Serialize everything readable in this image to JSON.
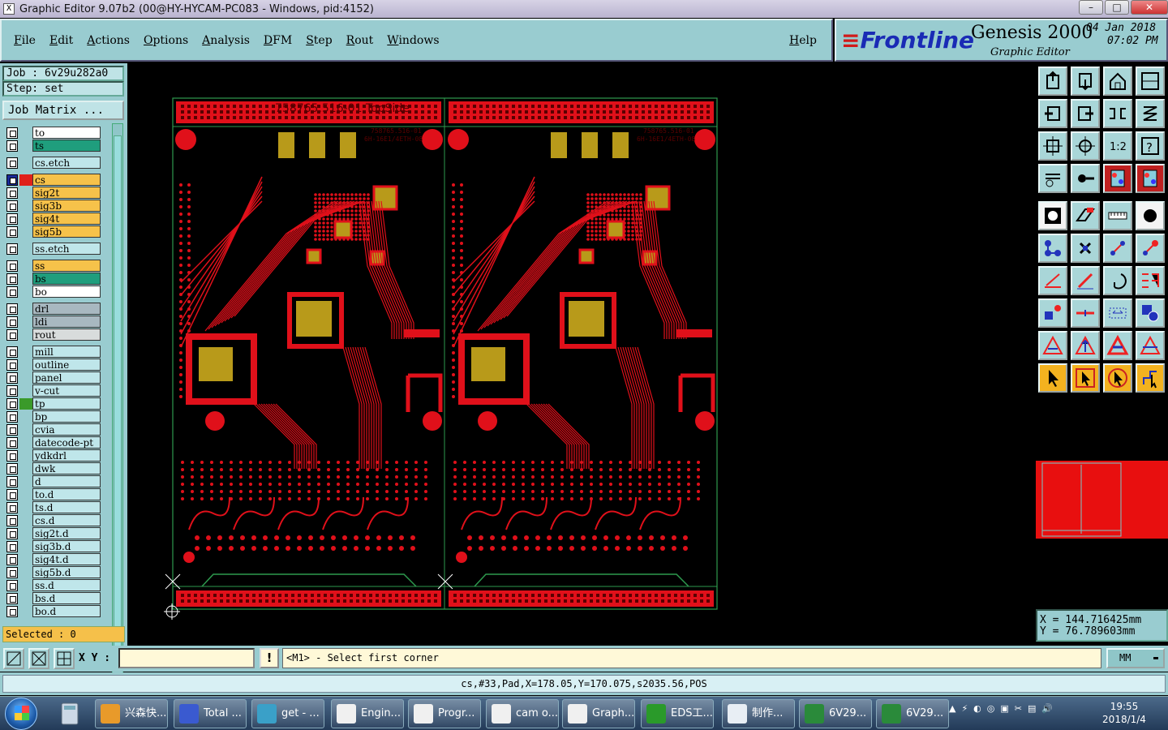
{
  "window": {
    "title": "Graphic Editor 9.07b2 (00@HY-HYCAM-PC083 - Windows, pid:4152)",
    "icon_label": "X"
  },
  "menu": {
    "items": [
      "File",
      "Edit",
      "Actions",
      "Options",
      "Analysis",
      "DFM",
      "Step",
      "Rout",
      "Windows"
    ],
    "help": "Help"
  },
  "brand": {
    "logo": "Frontline",
    "product": "Genesis 2000",
    "subtitle": "Graphic Editor",
    "date": "04 Jan 2018",
    "time": "07:02 PM"
  },
  "left": {
    "job": "Job : 6v29u282a0",
    "step": "Step: set",
    "job_matrix": "Job Matrix ...",
    "selected": "Selected : 0",
    "layers": [
      {
        "name": "to",
        "color": "#ffffff"
      },
      {
        "name": "ts",
        "color": "#1f9e7d"
      },
      {
        "name": "cs.etch",
        "color": "#bfe6ea"
      },
      {
        "name": "cs",
        "color": "#f6c24a",
        "active": true,
        "mark": "#e0201a"
      },
      {
        "name": "sig2t",
        "color": "#f6c24a"
      },
      {
        "name": "sig3b",
        "color": "#f6c24a"
      },
      {
        "name": "sig4t",
        "color": "#f6c24a"
      },
      {
        "name": "sig5b",
        "color": "#f6c24a"
      },
      {
        "name": "ss.etch",
        "color": "#bfe6ea"
      },
      {
        "name": "ss",
        "color": "#f6c24a"
      },
      {
        "name": "bs",
        "color": "#1f9e7d"
      },
      {
        "name": "bo",
        "color": "#ffffff"
      },
      {
        "name": "drl",
        "color": "#a8b8c0"
      },
      {
        "name": "ldi",
        "color": "#a8b8c0"
      },
      {
        "name": "rout",
        "color": "#d8dcdc"
      },
      {
        "name": "mill",
        "color": "#bfe6ea"
      },
      {
        "name": "outline",
        "color": "#bfe6ea"
      },
      {
        "name": "panel",
        "color": "#bfe6ea"
      },
      {
        "name": "v-cut",
        "color": "#bfe6ea"
      },
      {
        "name": "tp",
        "color": "#bfe6ea",
        "mark": "#3a9a2a"
      },
      {
        "name": "bp",
        "color": "#bfe6ea"
      },
      {
        "name": "cvia",
        "color": "#bfe6ea"
      },
      {
        "name": "datecode-pt",
        "color": "#bfe6ea"
      },
      {
        "name": "ydkdrl",
        "color": "#bfe6ea"
      },
      {
        "name": "dwk",
        "color": "#bfe6ea"
      },
      {
        "name": "d",
        "color": "#bfe6ea"
      },
      {
        "name": "to.d",
        "color": "#bfe6ea"
      },
      {
        "name": "ts.d",
        "color": "#bfe6ea"
      },
      {
        "name": "cs.d",
        "color": "#bfe6ea"
      },
      {
        "name": "sig2t.d",
        "color": "#bfe6ea"
      },
      {
        "name": "sig3b.d",
        "color": "#bfe6ea"
      },
      {
        "name": "sig4t.d",
        "color": "#bfe6ea"
      },
      {
        "name": "sig5b.d",
        "color": "#bfe6ea"
      },
      {
        "name": "ss.d",
        "color": "#bfe6ea"
      },
      {
        "name": "bs.d",
        "color": "#bfe6ea"
      },
      {
        "name": "bo.d",
        "color": "#bfe6ea"
      }
    ]
  },
  "board": {
    "title_left": "758765.516-01 TopSide",
    "small_text_1": "758765.516-01",
    "small_text_2": "6H-16E1/4ETH-08",
    "copper_color": "#e0101a",
    "pad_color": "#b89a1a",
    "outline_color": "#2e9a4e"
  },
  "coords": {
    "x": "X = 144.716425mm",
    "y": "Y = 76.789603mm"
  },
  "command": {
    "xy_label": "X Y :",
    "xy_value": "",
    "bang": "!",
    "prompt": "<M1> - Select first corner",
    "units": "MM"
  },
  "status": "cs,#33,Pad,X=178.05,Y=170.075,s2035.56,POS",
  "taskbar": {
    "buttons": [
      {
        "label": "兴森快...",
        "icon": "#e89a2a"
      },
      {
        "label": "Total ...",
        "icon": "#3a5ad0"
      },
      {
        "label": "get - ...",
        "icon": "#3aa0c8"
      },
      {
        "label": "Engin...",
        "icon": "#f0f0f0"
      },
      {
        "label": "Progr...",
        "icon": "#f0f0f0"
      },
      {
        "label": "cam o...",
        "icon": "#f0f0f0"
      },
      {
        "label": "Graph...",
        "icon": "#f0f0f0"
      },
      {
        "label": "EDS工...",
        "icon": "#2a9a2a"
      },
      {
        "label": "制作...",
        "icon": "#e8eef4"
      },
      {
        "label": "6V29...",
        "icon": "#2a8a3a"
      },
      {
        "label": "6V29...",
        "icon": "#2a8a3a"
      }
    ],
    "clock_time": "19:55",
    "clock_date": "2018/1/4"
  }
}
